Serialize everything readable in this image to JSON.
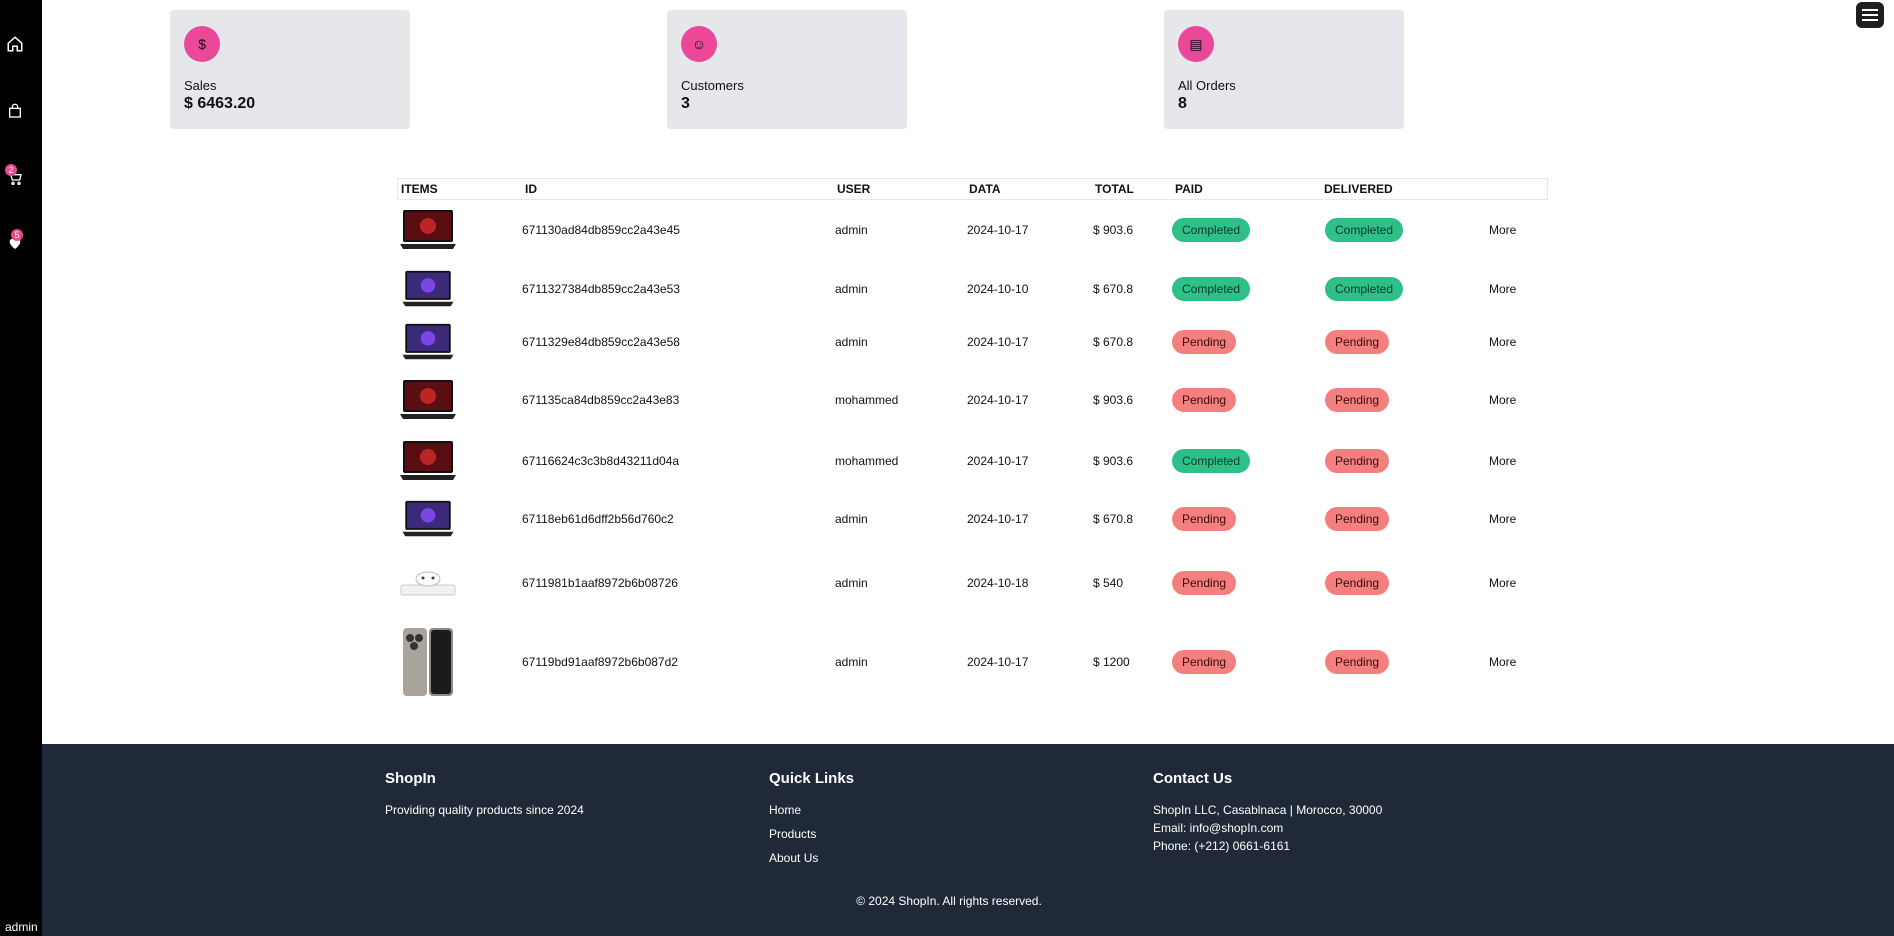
{
  "sidebar": {
    "icons": [
      "home-icon",
      "shopping-bag-icon",
      "cart-icon",
      "heart-icon"
    ],
    "cart_count": "2",
    "wishlist_count": "5",
    "user": "admin"
  },
  "stats": [
    {
      "label": "Sales",
      "value": "$ 6463.20",
      "icon": "dollar-icon"
    },
    {
      "label": "Customers",
      "value": "3",
      "icon": "smiley-icon"
    },
    {
      "label": "All Orders",
      "value": "8",
      "icon": "orders-icon"
    }
  ],
  "table": {
    "headers": {
      "items": "ITEMS",
      "id": "ID",
      "user": "USER",
      "date": "DATA",
      "total": "TOTAL",
      "paid": "PAID",
      "delivered": "DELIVERED"
    },
    "rows": [
      {
        "id": "671130ad84db859cc2a43e45",
        "user": "admin",
        "date": "2024-10-17",
        "total": "$ 903.6",
        "paid": "Completed",
        "delivered": "Completed",
        "more": "More",
        "image": "laptop-acer"
      },
      {
        "id": "6711327384db859cc2a43e53",
        "user": "admin",
        "date": "2024-10-10",
        "total": "$ 670.8",
        "paid": "Completed",
        "delivered": "Completed",
        "more": "More",
        "image": "laptop-msi"
      },
      {
        "id": "6711329e84db859cc2a43e58",
        "user": "admin",
        "date": "2024-10-17",
        "total": "$ 670.8",
        "paid": "Pending",
        "delivered": "Pending",
        "more": "More",
        "image": "laptop-msi"
      },
      {
        "id": "671135ca84db859cc2a43e83",
        "user": "mohammed",
        "date": "2024-10-17",
        "total": "$ 903.6",
        "paid": "Pending",
        "delivered": "Pending",
        "more": "More",
        "image": "laptop-acer"
      },
      {
        "id": "67116624c3c3b8d43211d04a",
        "user": "mohammed",
        "date": "2024-10-17",
        "total": "$ 903.6",
        "paid": "Completed",
        "delivered": "Pending",
        "more": "More",
        "image": "laptop-acer"
      },
      {
        "id": "67118eb61d6dff2b56d760c2",
        "user": "admin",
        "date": "2024-10-17",
        "total": "$ 670.8",
        "paid": "Pending",
        "delivered": "Pending",
        "more": "More",
        "image": "laptop-msi"
      },
      {
        "id": "6711981b1aaf8972b6b08726",
        "user": "admin",
        "date": "2024-10-18",
        "total": "$ 540",
        "paid": "Pending",
        "delivered": "Pending",
        "more": "More",
        "image": "console"
      },
      {
        "id": "67119bd91aaf8972b6b087d2",
        "user": "admin",
        "date": "2024-10-17",
        "total": "$ 1200",
        "paid": "Pending",
        "delivered": "Pending",
        "more": "More",
        "image": "phone"
      }
    ]
  },
  "footer": {
    "brand": "ShopIn",
    "tagline": "Providing quality products since 2024",
    "quick_links_title": "Quick Links",
    "links": [
      "Home",
      "Products",
      "About Us"
    ],
    "contact_title": "Contact Us",
    "address": "ShopIn LLC, Casablnaca | Morocco, 30000",
    "email": "Email: info@shopIn.com",
    "phone": "Phone: (+212) 0661-6161",
    "copyright": "© 2024 ShopIn. All rights reserved."
  },
  "colors": {
    "accent": "#ec4899",
    "completed": "#2fbf88",
    "pending": "#f47f7f",
    "footer_bg": "#1f2937"
  }
}
